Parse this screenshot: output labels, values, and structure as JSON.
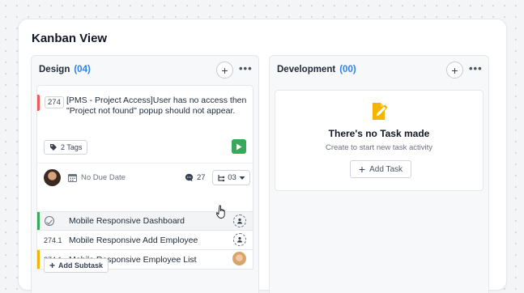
{
  "page": {
    "title": "Kanban View"
  },
  "columns": [
    {
      "name": "Design",
      "count": "(04)"
    },
    {
      "name": "Development",
      "count": "(00)"
    }
  ],
  "task": {
    "id": "274",
    "text": "[PMS - Project Access]User has no access then \"Project not found\" popup should not appear.",
    "tags_label": "2 Tags",
    "due_label": "No Due Date",
    "comments_count": "27",
    "subtasks_count": "03",
    "priority_color": "#ef5b5b"
  },
  "subtasks": [
    {
      "num": "",
      "title": "Mobile Responsive Dashboard",
      "bar_color": "#3aa85a",
      "completed": true
    },
    {
      "num": "274.1",
      "title": "Mobile Responsive Add Employee",
      "bar_color": "",
      "completed": false
    },
    {
      "num": "274.1",
      "title": "Mobile Responsive Employee List",
      "bar_color": "#f5b400",
      "completed": false
    }
  ],
  "add_subtask_label": "Add Subtask",
  "empty_state": {
    "title": "There's no Task made",
    "subtitle": "Create to start new task activity",
    "button_label": "Add Task",
    "icon": "note-edit-icon"
  },
  "colors": {
    "accent": "#2f80ed",
    "play": "#3aa85a",
    "empty_icon": "#f5b400"
  }
}
